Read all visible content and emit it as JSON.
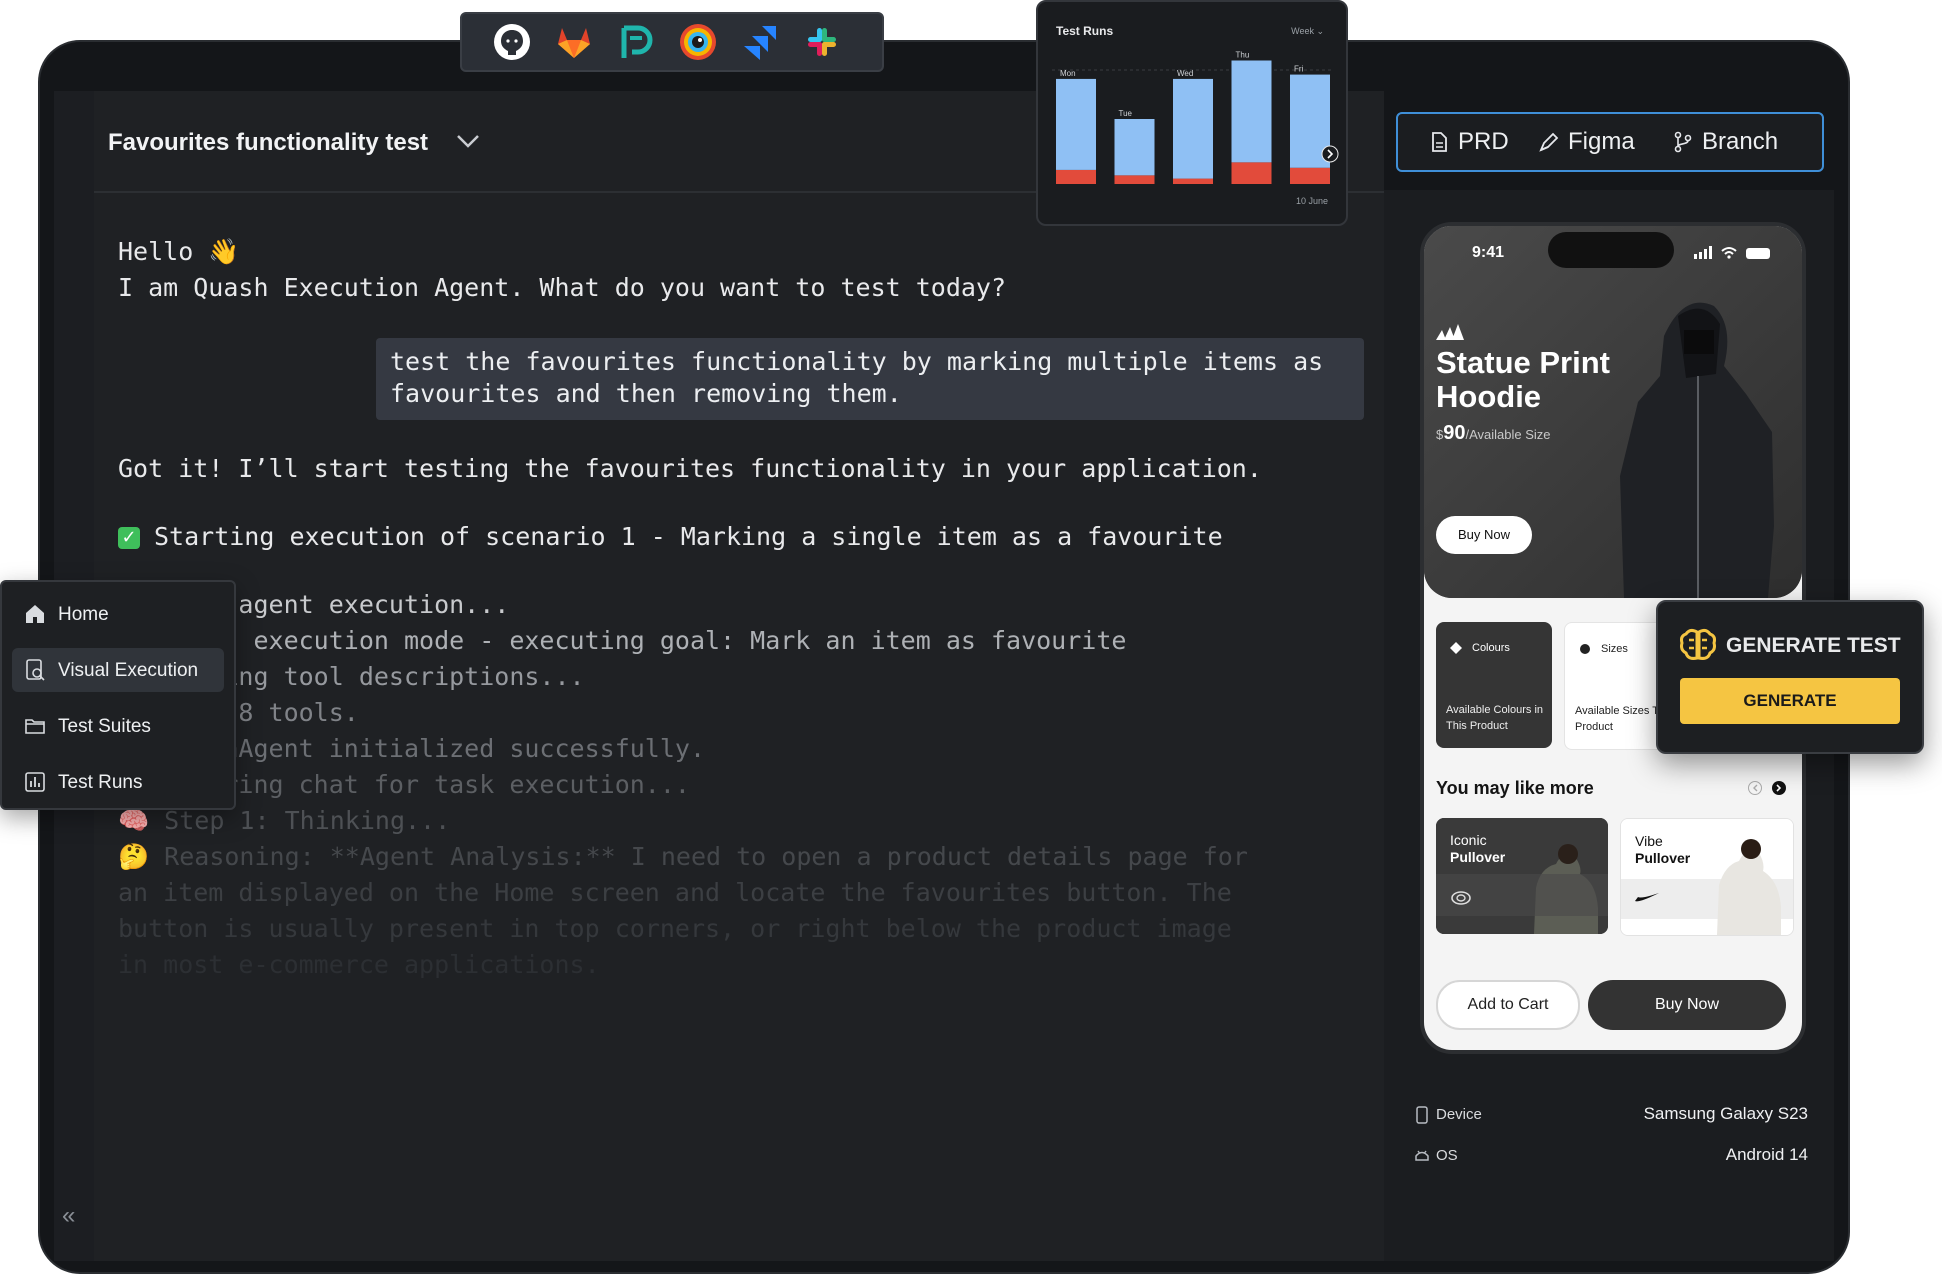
{
  "integrations": [
    "github-logo",
    "gitlab-logo",
    "linear-logo",
    "browserstack-logo",
    "jira-logo",
    "slack-logo"
  ],
  "header": {
    "title": "Favourites functionality test"
  },
  "chat": {
    "greeting": "Hello 👋",
    "intro": "I am Quash Execution Agent. What do you want to test today?",
    "user_message_line1": "test the favourites functionality by marking multiple items as",
    "user_message_line2": "favourites and then removing them.",
    "reply": "Got it! I’ll start testing the favourites functionality in your application.",
    "scenario": "Starting execution of scenario 1 - Marking a single item as a favourite",
    "log": [
      "        agent execution...",
      "       t execution mode - executing goal: Mark an item as favourite",
      "       ing tool descriptions...",
      "        8 tools.",
      "       hAgent initialized successfully.",
      "       ring chat for task execution...",
      "🧠 Step 1: Thinking...",
      "🤔 Reasoning: **Agent Analysis:** I need to open a product details page for",
      "an item displayed on the Home screen and locate the favourites button. The",
      "button is usually present in top corners, or right below the product image",
      "in most e-commerce applications."
    ]
  },
  "nav": {
    "items": [
      {
        "label": "Home",
        "icon": "home-icon"
      },
      {
        "label": "Visual Execution",
        "icon": "visual-execution-icon",
        "active": true
      },
      {
        "label": "Test Suites",
        "icon": "folder-icon"
      },
      {
        "label": "Test Runs",
        "icon": "test-runs-icon"
      }
    ]
  },
  "test_runs": {
    "title": "Test Runs",
    "period": "Week",
    "date": "10 June"
  },
  "chart_data": {
    "type": "bar",
    "title": "Test Runs",
    "categories": [
      "Mon",
      "Tue",
      "Wed",
      "Thu",
      "Fri"
    ],
    "series": [
      {
        "name": "passed",
        "values": [
          84,
          52,
          92,
          94,
          86
        ],
        "color": "#8fc0f4"
      },
      {
        "name": "failed",
        "values": [
          13,
          8,
          5,
          20,
          15
        ],
        "color": "#e24b3b"
      }
    ],
    "ylim": [
      0,
      120
    ]
  },
  "links": {
    "prd": "PRD",
    "figma": "Figma",
    "branch": "Branch"
  },
  "phone": {
    "time": "9:41",
    "product_title": "Statue Print Hoodie",
    "price_currency": "$",
    "price": "90",
    "price_suffix": "/Available Size",
    "buy_now_hero": "Buy Now",
    "colours_title": "Colours",
    "colours_desc": "Available Colours in This Product",
    "sizes_title": "Sizes",
    "sizes_desc": "Available Sizes This Product",
    "you_may_like": "You may like more",
    "product1": "Iconic Pullover",
    "product1_a": "Iconic",
    "product1_b": "Pullover",
    "product2_a": "Vibe",
    "product2_b": "Pullover",
    "add_to_cart": "Add to Cart",
    "buy_now": "Buy Now"
  },
  "device_info": {
    "device_label": "Device",
    "device_value": "Samsung Galaxy S23",
    "os_label": "OS",
    "os_value": "Android 14"
  },
  "generate": {
    "title": "GENERATE TEST",
    "button": "GENERATE"
  },
  "colors": {
    "accent": "#3f8fd8",
    "generate_button": "#f5c542",
    "panel": "#1f2124"
  }
}
